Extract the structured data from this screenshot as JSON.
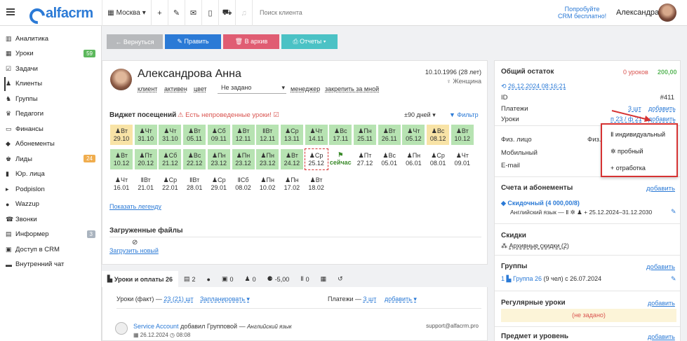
{
  "top": {
    "brand": "alfacrm",
    "city": "Москва",
    "search_placeholder": "Поиск клиента",
    "promo_line1": "Попробуйте",
    "promo_line2": "CRM бесплатно!",
    "user": "Александра"
  },
  "sidebar": [
    {
      "icon": "chart-icon",
      "label": "Аналитика"
    },
    {
      "icon": "calendar-icon",
      "label": "Уроки",
      "badge": "59",
      "badge_color": "#5cb85c"
    },
    {
      "icon": "tasks-icon",
      "label": "Задачи"
    },
    {
      "icon": "user-icon",
      "label": "Клиенты",
      "active": true
    },
    {
      "icon": "group-icon",
      "label": "Группы"
    },
    {
      "icon": "teacher-icon",
      "label": "Педагоги"
    },
    {
      "icon": "money-icon",
      "label": "Финансы"
    },
    {
      "icon": "tag-icon",
      "label": "Абонементы"
    },
    {
      "icon": "leads-icon",
      "label": "Лиды",
      "badge": "24",
      "badge_color": "#f0ad4e"
    },
    {
      "icon": "building-icon",
      "label": "Юр. лица"
    },
    {
      "icon": "podpislon-icon",
      "label": "Podpislon"
    },
    {
      "icon": "wazzup-icon",
      "label": "Wazzup"
    },
    {
      "icon": "phone-icon",
      "label": "Звонки"
    },
    {
      "icon": "info-icon",
      "label": "Информер",
      "badge": "3",
      "badge_color": "#aab4bf"
    },
    {
      "icon": "lock-icon",
      "label": "Доступ в CRM"
    },
    {
      "icon": "chat-icon",
      "label": "Внутренний чат"
    }
  ],
  "actions": {
    "back": "← Вернуться",
    "edit": "✎ Править",
    "archive": "🗑 В архив",
    "reports": "⎙ Отчеты ▾"
  },
  "client": {
    "name": "Александрова Анна",
    "birth": "10.10.1996 (28 лет)",
    "gender": "♀ Женщина",
    "tags": [
      "клиент",
      "активен",
      "цвет"
    ],
    "status_select": "Не задано",
    "manager": "менеджер",
    "pin": "закрепить за мной"
  },
  "widget": {
    "title": "Виджет посещений",
    "warning": "⚠ Есть непроведенные уроки! ☑",
    "range": "±90 дней ▾",
    "filter": "▼ Фильтр",
    "legend": "Показать легенду",
    "now": "сейчас"
  },
  "visits": [
    {
      "d": "♟Вт",
      "n": "29.10",
      "c": "y"
    },
    {
      "d": "♟Чт",
      "n": "31.10",
      "c": "g"
    },
    {
      "d": "♟Чт",
      "n": "31.10",
      "c": "g"
    },
    {
      "d": "♟Вт",
      "n": "05.11",
      "c": "g"
    },
    {
      "d": "♟Сб",
      "n": "09.11",
      "c": "g"
    },
    {
      "d": "♟Вт",
      "n": "12.11",
      "c": "g"
    },
    {
      "d": "ⅡВт",
      "n": "12.11",
      "c": "g"
    },
    {
      "d": "♟Ср",
      "n": "13.11",
      "c": "g"
    },
    {
      "d": "♟Чт",
      "n": "14.11",
      "c": "g"
    },
    {
      "d": "♟Вс",
      "n": "17.11",
      "c": "g"
    },
    {
      "d": "♟Пн",
      "n": "25.11",
      "c": "g"
    },
    {
      "d": "♟Вт",
      "n": "26.11",
      "c": "g"
    },
    {
      "d": "♟Чт",
      "n": "05.12",
      "c": "g"
    },
    {
      "d": "♟Вс",
      "n": "08.12",
      "c": "y"
    },
    {
      "d": "♟Вт",
      "n": "10.12",
      "c": "g"
    },
    {
      "d": "♟Вт",
      "n": "10.12",
      "c": "g"
    },
    {
      "d": "♟Пт",
      "n": "20.12",
      "c": "g"
    },
    {
      "d": "♟Сб",
      "n": "21.12",
      "c": "g"
    },
    {
      "d": "♟Вс",
      "n": "22.12",
      "c": "g"
    },
    {
      "d": "♟Пн",
      "n": "23.12",
      "c": "g"
    },
    {
      "d": "♟Пн",
      "n": "23.12",
      "c": "g"
    },
    {
      "d": "♟Пн",
      "n": "23.12",
      "c": "g"
    },
    {
      "d": "♟Вт",
      "n": "24.12",
      "c": "g"
    },
    {
      "d": "♟Ср",
      "n": "25.12",
      "c": "w"
    },
    {
      "d": "",
      "n": "",
      "c": "now"
    },
    {
      "d": "♟Пт",
      "n": "27.12",
      "c": "w"
    },
    {
      "d": "♟Вс",
      "n": "05.01",
      "c": "w"
    },
    {
      "d": "♟Пн",
      "n": "06.01",
      "c": "w"
    },
    {
      "d": "♟Ср",
      "n": "08.01",
      "c": "w"
    },
    {
      "d": "♟Чт",
      "n": "09.01",
      "c": "w"
    },
    {
      "d": "♟Чт",
      "n": "16.01",
      "c": "w"
    },
    {
      "d": "ⅡВт",
      "n": "21.01",
      "c": "w"
    },
    {
      "d": "♟Ср",
      "n": "22.01",
      "c": "w"
    },
    {
      "d": "ⅡВт",
      "n": "28.01",
      "c": "w"
    },
    {
      "d": "♟Ср",
      "n": "29.01",
      "c": "w"
    },
    {
      "d": "ⅡСб",
      "n": "08.02",
      "c": "w"
    },
    {
      "d": "♟Пн",
      "n": "10.02",
      "c": "w"
    },
    {
      "d": "♟Пн",
      "n": "17.02",
      "c": "w"
    },
    {
      "d": "♟Вт",
      "n": "18.02",
      "c": "w"
    }
  ],
  "files": {
    "title": "Загруженные файлы",
    "upload": "Загрузить новый"
  },
  "tabs": [
    "Уроки и оплаты 26",
    "2",
    "",
    "0",
    "0",
    "-5,00",
    "0",
    "",
    ""
  ],
  "lessons": {
    "fact": "Уроки (факт) — ",
    "fact_link": "23 (21) шт",
    "planned": "Запланировать ▾",
    "payments": "Платежи — ",
    "pay_link": "3 шт",
    "add": "добавить ▾"
  },
  "log": {
    "author": "Service Account",
    "action": "добавил Групповой —",
    "subject": "Английский язык",
    "date": "26.12.2024",
    "time": "08:08",
    "email": "support@alfacrm.pro"
  },
  "balance": {
    "title": "Общий остаток",
    "lessons": "0 уроков",
    "money": "200,00",
    "date": "26.12.2024 08:16:21",
    "id_label": "ID",
    "id": "#411",
    "payments": "Платежи",
    "pay_count": "3 шт",
    "add": "добавить",
    "lessons_label": "Уроки",
    "lessons_val": "п 23 / ф 21",
    "add2": "добавить"
  },
  "contacts": {
    "legal": "Физ. лицо",
    "legal2": "Физ.",
    "mobile": "Мобильный",
    "email": "E-mail"
  },
  "dropdown": [
    "Ⅱ индивидуальный",
    "✲ пробный",
    "+ отработка"
  ],
  "accounts": {
    "title": "Счета и абонементы",
    "add": "добавить",
    "sub": "Скидочный (4 000,00/8)",
    "sub_detail": "Английский язык — Ⅱ ✲ ♟ +  25.12.2024–31.12.2030"
  },
  "discounts": {
    "title": "Скидки",
    "archive": "Архивные скидки (2)"
  },
  "groups": {
    "title": "Группы",
    "add": "добавить",
    "item": "Группа 26",
    "detail": "(9 чел) с 26.07.2024"
  },
  "regular": {
    "title": "Регулярные уроки",
    "add": "добавить",
    "empty": "(не задано)"
  },
  "subject": {
    "title": "Предмет и уровень",
    "add": "добавить"
  },
  "colors": {
    "accent": "#2b7ad6",
    "green": "#5cb85c",
    "red": "#d9534f",
    "teal": "#4bc2c5",
    "grey": "#aab4bf"
  }
}
